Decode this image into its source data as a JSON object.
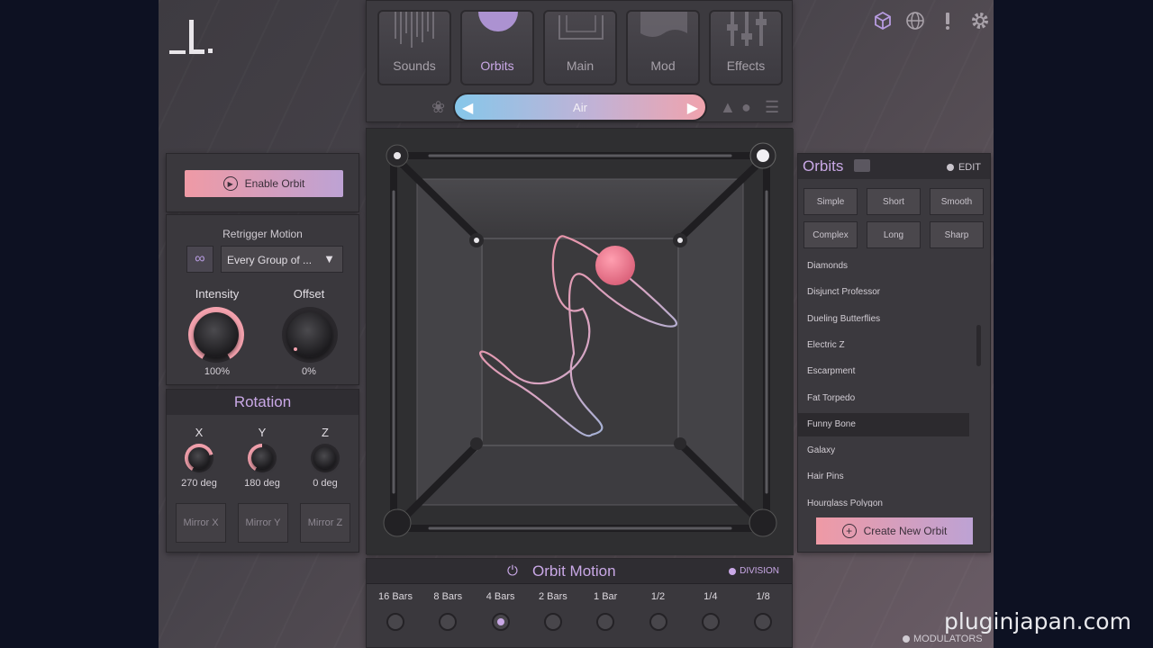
{
  "tabs": [
    {
      "label": "Sounds",
      "active": false
    },
    {
      "label": "Orbits",
      "active": true
    },
    {
      "label": "Main",
      "active": false
    },
    {
      "label": "Mod",
      "active": false
    },
    {
      "label": "Effects",
      "active": false
    }
  ],
  "sound_selector": {
    "name": "Air",
    "prev_icon": "triangle-left-icon",
    "next_icon": "triangle-right-icon"
  },
  "top_icons": [
    "cube-icon",
    "globe-icon",
    "exclamation-icon",
    "gear-icon"
  ],
  "enable_orbit": {
    "label": "Enable Orbit"
  },
  "retrigger": {
    "title": "Retrigger Motion",
    "mode": "Every Group of ...",
    "intensity": {
      "label": "Intensity",
      "value": "100%",
      "fraction": 1.0
    },
    "offset": {
      "label": "Offset",
      "value": "0%",
      "fraction": 0.0
    }
  },
  "rotation": {
    "title": "Rotation",
    "axes": [
      {
        "label": "X",
        "value": "270 deg",
        "degrees": 270
      },
      {
        "label": "Y",
        "value": "180 deg",
        "degrees": 180
      },
      {
        "label": "Z",
        "value": "0 deg",
        "degrees": 0
      }
    ],
    "mirrors": [
      "Mirror X",
      "Mirror Y",
      "Mirror Z"
    ]
  },
  "orbit_motion": {
    "title": "Orbit Motion",
    "division_label": "DIVISION",
    "options": [
      "16 Bars",
      "8 Bars",
      "4 Bars",
      "2 Bars",
      "1 Bar",
      "1/2",
      "1/4",
      "1/8"
    ],
    "selected": "4 Bars"
  },
  "orbits_panel": {
    "title": "Orbits",
    "edit_label": "EDIT",
    "presets": [
      "Simple",
      "Short",
      "Smooth",
      "Complex",
      "Long",
      "Sharp"
    ],
    "items": [
      "Diamonds",
      "Disjunct Professor",
      "Dueling Butterflies",
      "Electric Z",
      "Escarpment",
      "Fat Torpedo",
      "Funny Bone",
      "Galaxy",
      "Hair Pins",
      "Hourglass Polygon"
    ],
    "selected": "Funny Bone",
    "create_label": "Create New Orbit"
  },
  "modulators_label": "MODULATORS",
  "watermark": "pluginjapan.com",
  "colors": {
    "accent": "#c9a8e6",
    "pink": "#ef9aa5",
    "blue": "#86c7ea",
    "background": "#0d1122"
  }
}
